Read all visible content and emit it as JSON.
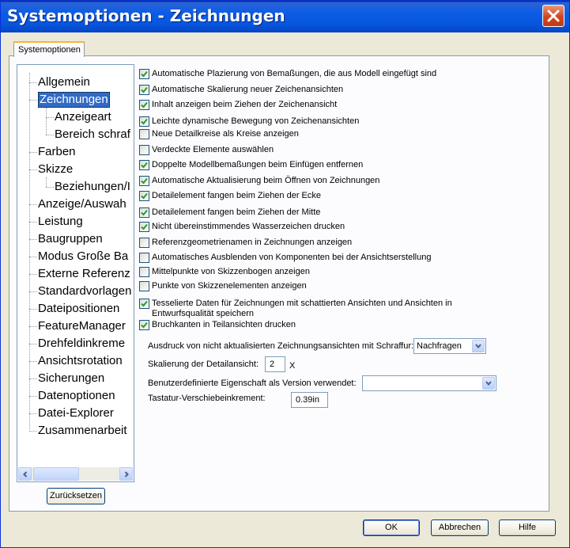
{
  "window": {
    "title": "Systemoptionen - Zeichnungen"
  },
  "tab": {
    "label": "Systemoptionen"
  },
  "tree": {
    "items": [
      {
        "label": "Allgemein",
        "level": 0,
        "selected": false
      },
      {
        "label": "Zeichnungen",
        "level": 0,
        "selected": true
      },
      {
        "label": "Anzeigeart",
        "level": 1,
        "selected": false
      },
      {
        "label": "Bereich schraf",
        "level": 1,
        "selected": false
      },
      {
        "label": "Farben",
        "level": 0,
        "selected": false
      },
      {
        "label": "Skizze",
        "level": 0,
        "selected": false
      },
      {
        "label": "Beziehungen/I",
        "level": 1,
        "selected": false
      },
      {
        "label": "Anzeige/Auswah",
        "level": 0,
        "selected": false
      },
      {
        "label": "Leistung",
        "level": 0,
        "selected": false
      },
      {
        "label": "Baugruppen",
        "level": 0,
        "selected": false
      },
      {
        "label": "Modus Große Ba",
        "level": 0,
        "selected": false
      },
      {
        "label": "Externe Referenz",
        "level": 0,
        "selected": false
      },
      {
        "label": "Standardvorlagen",
        "level": 0,
        "selected": false
      },
      {
        "label": "Dateipositionen",
        "level": 0,
        "selected": false
      },
      {
        "label": "FeatureManager",
        "level": 0,
        "selected": false
      },
      {
        "label": "Drehfeldinkreme",
        "level": 0,
        "selected": false
      },
      {
        "label": "Ansichtsrotation",
        "level": 0,
        "selected": false
      },
      {
        "label": "Sicherungen",
        "level": 0,
        "selected": false
      },
      {
        "label": "Datenoptionen",
        "level": 0,
        "selected": false
      },
      {
        "label": "Datei-Explorer",
        "level": 0,
        "selected": false
      },
      {
        "label": "Zusammenarbeit",
        "level": 0,
        "selected": false
      }
    ]
  },
  "reset_button": "Zurücksetzen",
  "options": [
    {
      "label": "Automatische Plazierung von Bemaßungen, die aus Modell eingefügt sind",
      "checked": true
    },
    {
      "label": "Automatische Skalierung neuer Zeichenansichten",
      "checked": true
    },
    {
      "label": "Inhalt anzeigen beim Ziehen der Zeichenansicht",
      "checked": true
    },
    {
      "label": "Leichte dynamische Bewegung von Zeichenansichten",
      "checked": true
    },
    {
      "label": "Neue Detailkreise als Kreise anzeigen",
      "checked": false
    },
    {
      "label": "Verdeckte Elemente auswählen",
      "checked": false
    },
    {
      "label": "Doppelte Modellbemaßungen beim Einfügen entfernen",
      "checked": true
    },
    {
      "label": "Automatische Aktualisierung beim Öffnen von Zeichnungen",
      "checked": true
    },
    {
      "label": "Detailelement fangen beim Ziehen der Ecke",
      "checked": true
    },
    {
      "label": "Detailelement fangen beim Ziehen der Mitte",
      "checked": true
    },
    {
      "label": "Nicht übereinstimmendes Wasserzeichen drucken",
      "checked": true
    },
    {
      "label": "Referenzgeometrienamen in Zeichnungen anzeigen",
      "checked": false
    },
    {
      "label": "Automatisches Ausblenden von Komponenten bei der Ansichtserstellung",
      "checked": false
    },
    {
      "label": "Mittelpunkte von Skizzenbogen anzeigen",
      "checked": false
    },
    {
      "label": "Punkte von Skizzenelementen anzeigen",
      "checked": false
    },
    {
      "label": "Tesselierte Daten für Zeichnungen mit schattierten Ansichten und Ansichten in",
      "label2": "Entwurfsqualität speichern",
      "checked": true
    },
    {
      "label": "Bruchkanten in Teilansichten drucken",
      "checked": true
    }
  ],
  "hatch": {
    "label": "Ausdruck von nicht aktualisierten Zeichnungsansichten mit Schraffur:",
    "value": "Nachfragen"
  },
  "detail_scale": {
    "label": "Skalierung der Detailansicht:",
    "value": "2",
    "unit": "X"
  },
  "custom_prop": {
    "label": "Benutzerdefinierte Eigenschaft als Version verwendet:",
    "value": ""
  },
  "nudge": {
    "label": "Tastatur-Verschiebeinkrement:",
    "value": "0.39in"
  },
  "buttons": {
    "ok": "OK",
    "cancel": "Abbrechen",
    "help": "Hilfe"
  }
}
